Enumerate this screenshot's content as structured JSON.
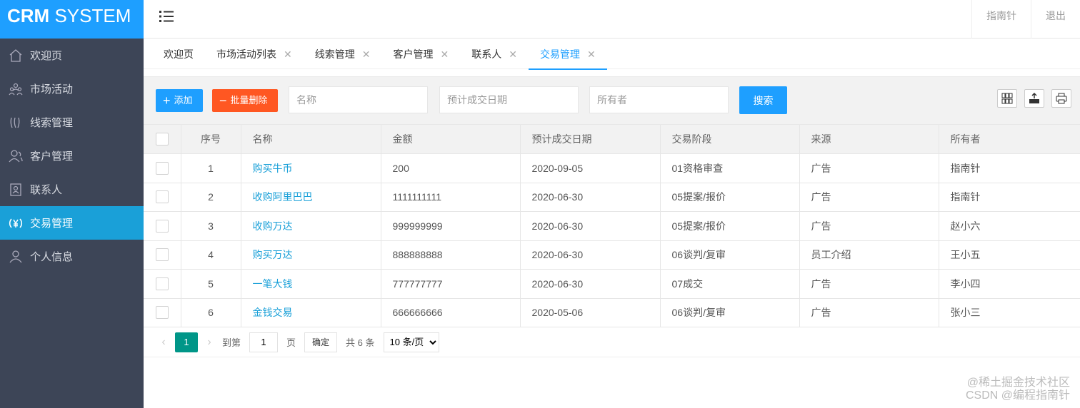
{
  "app": {
    "logo_bold": "CRM",
    "logo_rest": " SYSTEM"
  },
  "sidebar": {
    "items": [
      {
        "label": "欢迎页",
        "icon": "home-icon"
      },
      {
        "label": "市场活动",
        "icon": "users-group-icon"
      },
      {
        "label": "线索管理",
        "icon": "lines-icon"
      },
      {
        "label": "客户管理",
        "icon": "user-icon"
      },
      {
        "label": "联系人",
        "icon": "contact-card-icon"
      },
      {
        "label": "交易管理",
        "icon": "yen-circle-icon",
        "active": true
      },
      {
        "label": "个人信息",
        "icon": "person-icon"
      }
    ]
  },
  "header": {
    "user": "指南针",
    "logout": "退出"
  },
  "tabs": [
    {
      "label": "欢迎页",
      "closable": false
    },
    {
      "label": "市场活动列表",
      "closable": true
    },
    {
      "label": "线索管理",
      "closable": true
    },
    {
      "label": "客户管理",
      "closable": true
    },
    {
      "label": "联系人",
      "closable": true
    },
    {
      "label": "交易管理",
      "closable": true,
      "active": true
    }
  ],
  "tab_close_glyph": "✕",
  "toolbar": {
    "add_label": "添加",
    "batch_delete_label": "批量删除",
    "name_placeholder": "名称",
    "date_placeholder": "预计成交日期",
    "owner_placeholder": "所有者",
    "search_label": "搜索"
  },
  "table": {
    "headers": [
      "序号",
      "名称",
      "金额",
      "预计成交日期",
      "交易阶段",
      "来源",
      "所有者"
    ],
    "rows": [
      [
        "1",
        "购买牛币",
        "200",
        "2020-09-05",
        "01资格审查",
        "广告",
        "指南针"
      ],
      [
        "2",
        "收购阿里巴巴",
        "1111111111",
        "2020-06-30",
        "05提案/报价",
        "广告",
        "指南针"
      ],
      [
        "3",
        "收购万达",
        "999999999",
        "2020-06-30",
        "05提案/报价",
        "广告",
        "赵小六"
      ],
      [
        "4",
        "购买万达",
        "888888888",
        "2020-06-30",
        "06谈判/复审",
        "员工介绍",
        "王小五"
      ],
      [
        "5",
        "一笔大钱",
        "777777777",
        "2020-06-30",
        "07成交",
        "广告",
        "李小四"
      ],
      [
        "6",
        "金钱交易",
        "666666666",
        "2020-05-06",
        "06谈判/复审",
        "广告",
        "张小三"
      ]
    ]
  },
  "pager": {
    "current": "1",
    "goto_label": "到第",
    "goto_value": "1",
    "page_unit": "页",
    "confirm": "确定",
    "total": "共 6 条",
    "page_size": "10 条/页"
  },
  "watermark": {
    "line1": "@稀土掘金技术社区",
    "line2": "CSDN @编程指南针"
  },
  "colors": {
    "primary": "#1e9fff",
    "danger": "#ff5722",
    "sidebar": "#3d4557",
    "active_nav": "#1aa0d8",
    "pager_active": "#009688"
  }
}
